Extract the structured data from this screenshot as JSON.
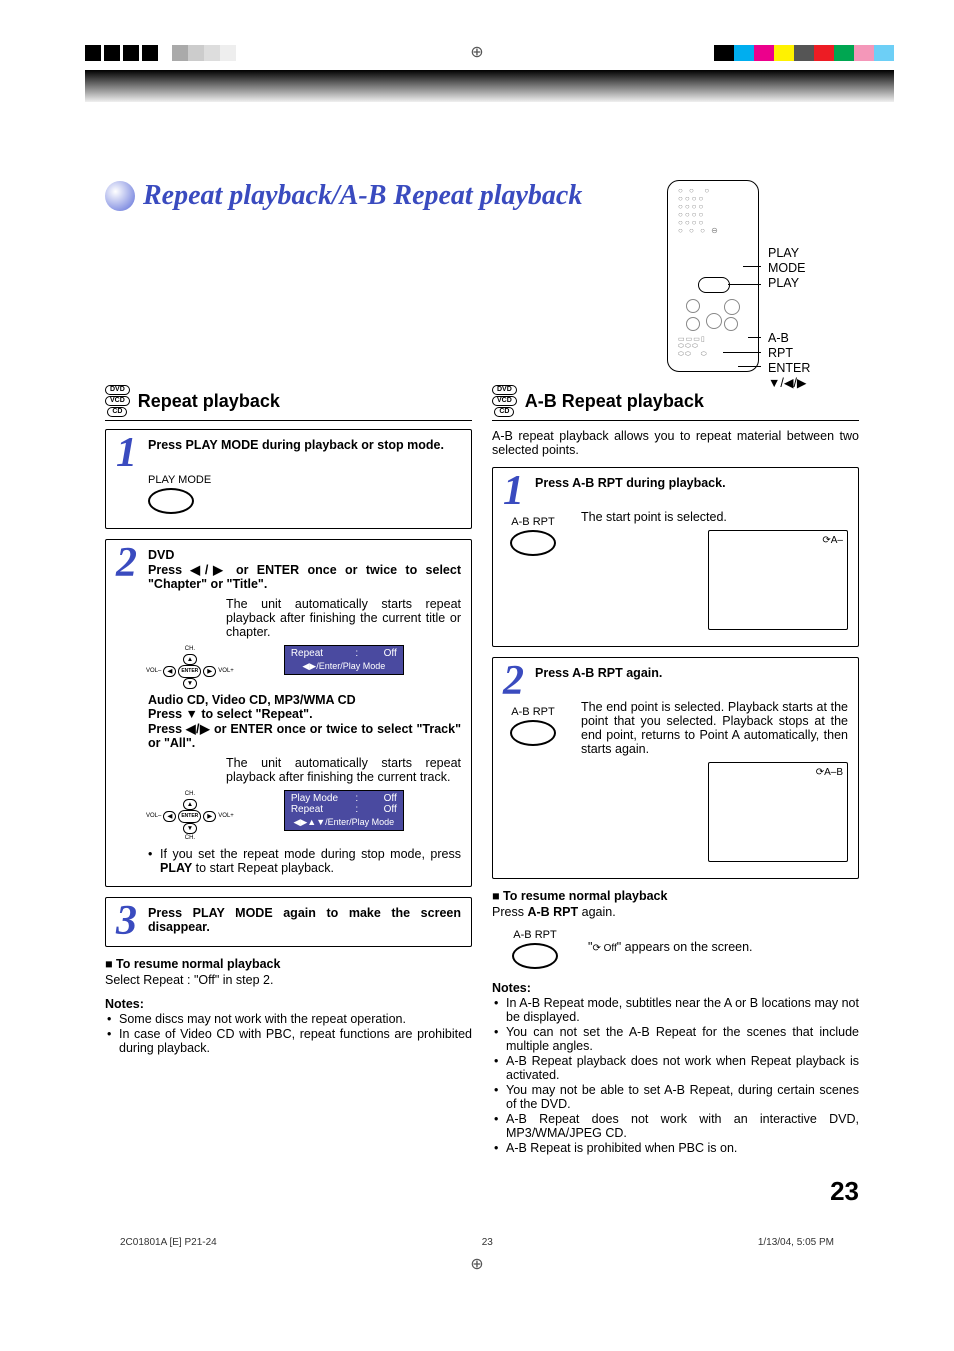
{
  "page": {
    "title": "Repeat playback/A-B Repeat playback",
    "number": "23"
  },
  "remote_labels": {
    "play_mode": "PLAY MODE",
    "play": "PLAY",
    "ab_rpt": "A-B RPT",
    "enter": "ENTER",
    "arrows": "▼/◀/▶"
  },
  "disc_types": {
    "dvd": "DVD",
    "vcd": "VCD",
    "cd": "CD"
  },
  "left": {
    "heading": "Repeat playback",
    "step1": {
      "text": "Press PLAY MODE during playback or stop mode.",
      "btn_label": "PLAY MODE"
    },
    "step2": {
      "title": "DVD",
      "line1": "Press ◀/▶ or ENTER once or twice to select \"Chapter\" or \"Title\".",
      "body1": "The unit automatically starts repeat playback after finishing the current title or chapter.",
      "osd1": {
        "label": "Repeat",
        "colon": ":",
        "value": "Off",
        "foot": "◀▶/Enter/Play Mode"
      },
      "pad": {
        "ch_up": "CH.",
        "vol_dn": "VOL–",
        "vol_up": "VOL+",
        "enter": "ENTER"
      },
      "audio_head": "Audio CD, Video CD, MP3/WMA CD",
      "audio_l2": "Press ▼ to select \"Repeat\".",
      "audio_l3": "Press ◀/▶ or ENTER once or twice to select \"Track\" or \"All\".",
      "body2": "The unit automatically starts repeat playback after finishing the current track.",
      "osd2": {
        "r1l": "Play Mode",
        "r1c": ":",
        "r1v": "Off",
        "r2l": "Repeat",
        "r2c": ":",
        "r2v": "Off",
        "foot": "◀▶▲▼/Enter/Play Mode"
      },
      "bullet": "If you set the repeat mode during stop mode, press PLAY to start Repeat playback."
    },
    "step3": {
      "text": "Press PLAY MODE again to make the screen disappear."
    },
    "resume_head": "To resume normal playback",
    "resume_body": "Select Repeat : \"Off\" in step 2.",
    "notes_head": "Notes:",
    "notes": [
      "Some discs may not work with the repeat operation.",
      "In case of Video CD with PBC, repeat functions are prohibited during playback."
    ]
  },
  "right": {
    "heading": "A-B Repeat playback",
    "intro": "A-B repeat playback allows you to repeat material between two selected points.",
    "step1": {
      "text": "Press A-B RPT during playback.",
      "btn_label": "A-B RPT",
      "body": "The start point is selected.",
      "screen_icon": "⟳A–"
    },
    "step2": {
      "text": "Press A-B RPT again.",
      "btn_label": "A-B RPT",
      "body": "The end point is selected. Playback starts at the point that you selected. Playback stops at the end point, returns to Point A automatically, then starts again.",
      "screen_icon": "⟳A–B"
    },
    "resume_head": "To resume normal playback",
    "resume_body_pre": "Press ",
    "resume_body_btn": "A-B RPT",
    "resume_body_post": " again.",
    "resume_btn_label": "A-B RPT",
    "resume_off_pre": "\"",
    "resume_off_icon": "⟳ Off",
    "resume_off_post": "\" appears on the screen.",
    "notes_head": "Notes:",
    "notes": [
      "In A-B Repeat mode, subtitles near the A or B locations may not be displayed.",
      "You can not set the A-B Repeat for the scenes that include multiple angles.",
      "A-B Repeat playback does not work when Repeat playback is activated.",
      "You may not be able to set A-B Repeat, during certain scenes of the DVD.",
      "A-B Repeat does not work with an interactive DVD, MP3/WMA/JPEG CD.",
      "A-B Repeat is prohibited when PBC is on."
    ]
  },
  "footer": {
    "file": "2C01801A [E] P21-24",
    "page": "23",
    "datetime": "1/13/04, 5:05 PM"
  },
  "color_squares": [
    "#000000",
    "#00aeef",
    "#ec008c",
    "#fff200",
    "#555",
    "#ed1c24",
    "#00a651",
    "#f497b9",
    "#6dcff6"
  ]
}
